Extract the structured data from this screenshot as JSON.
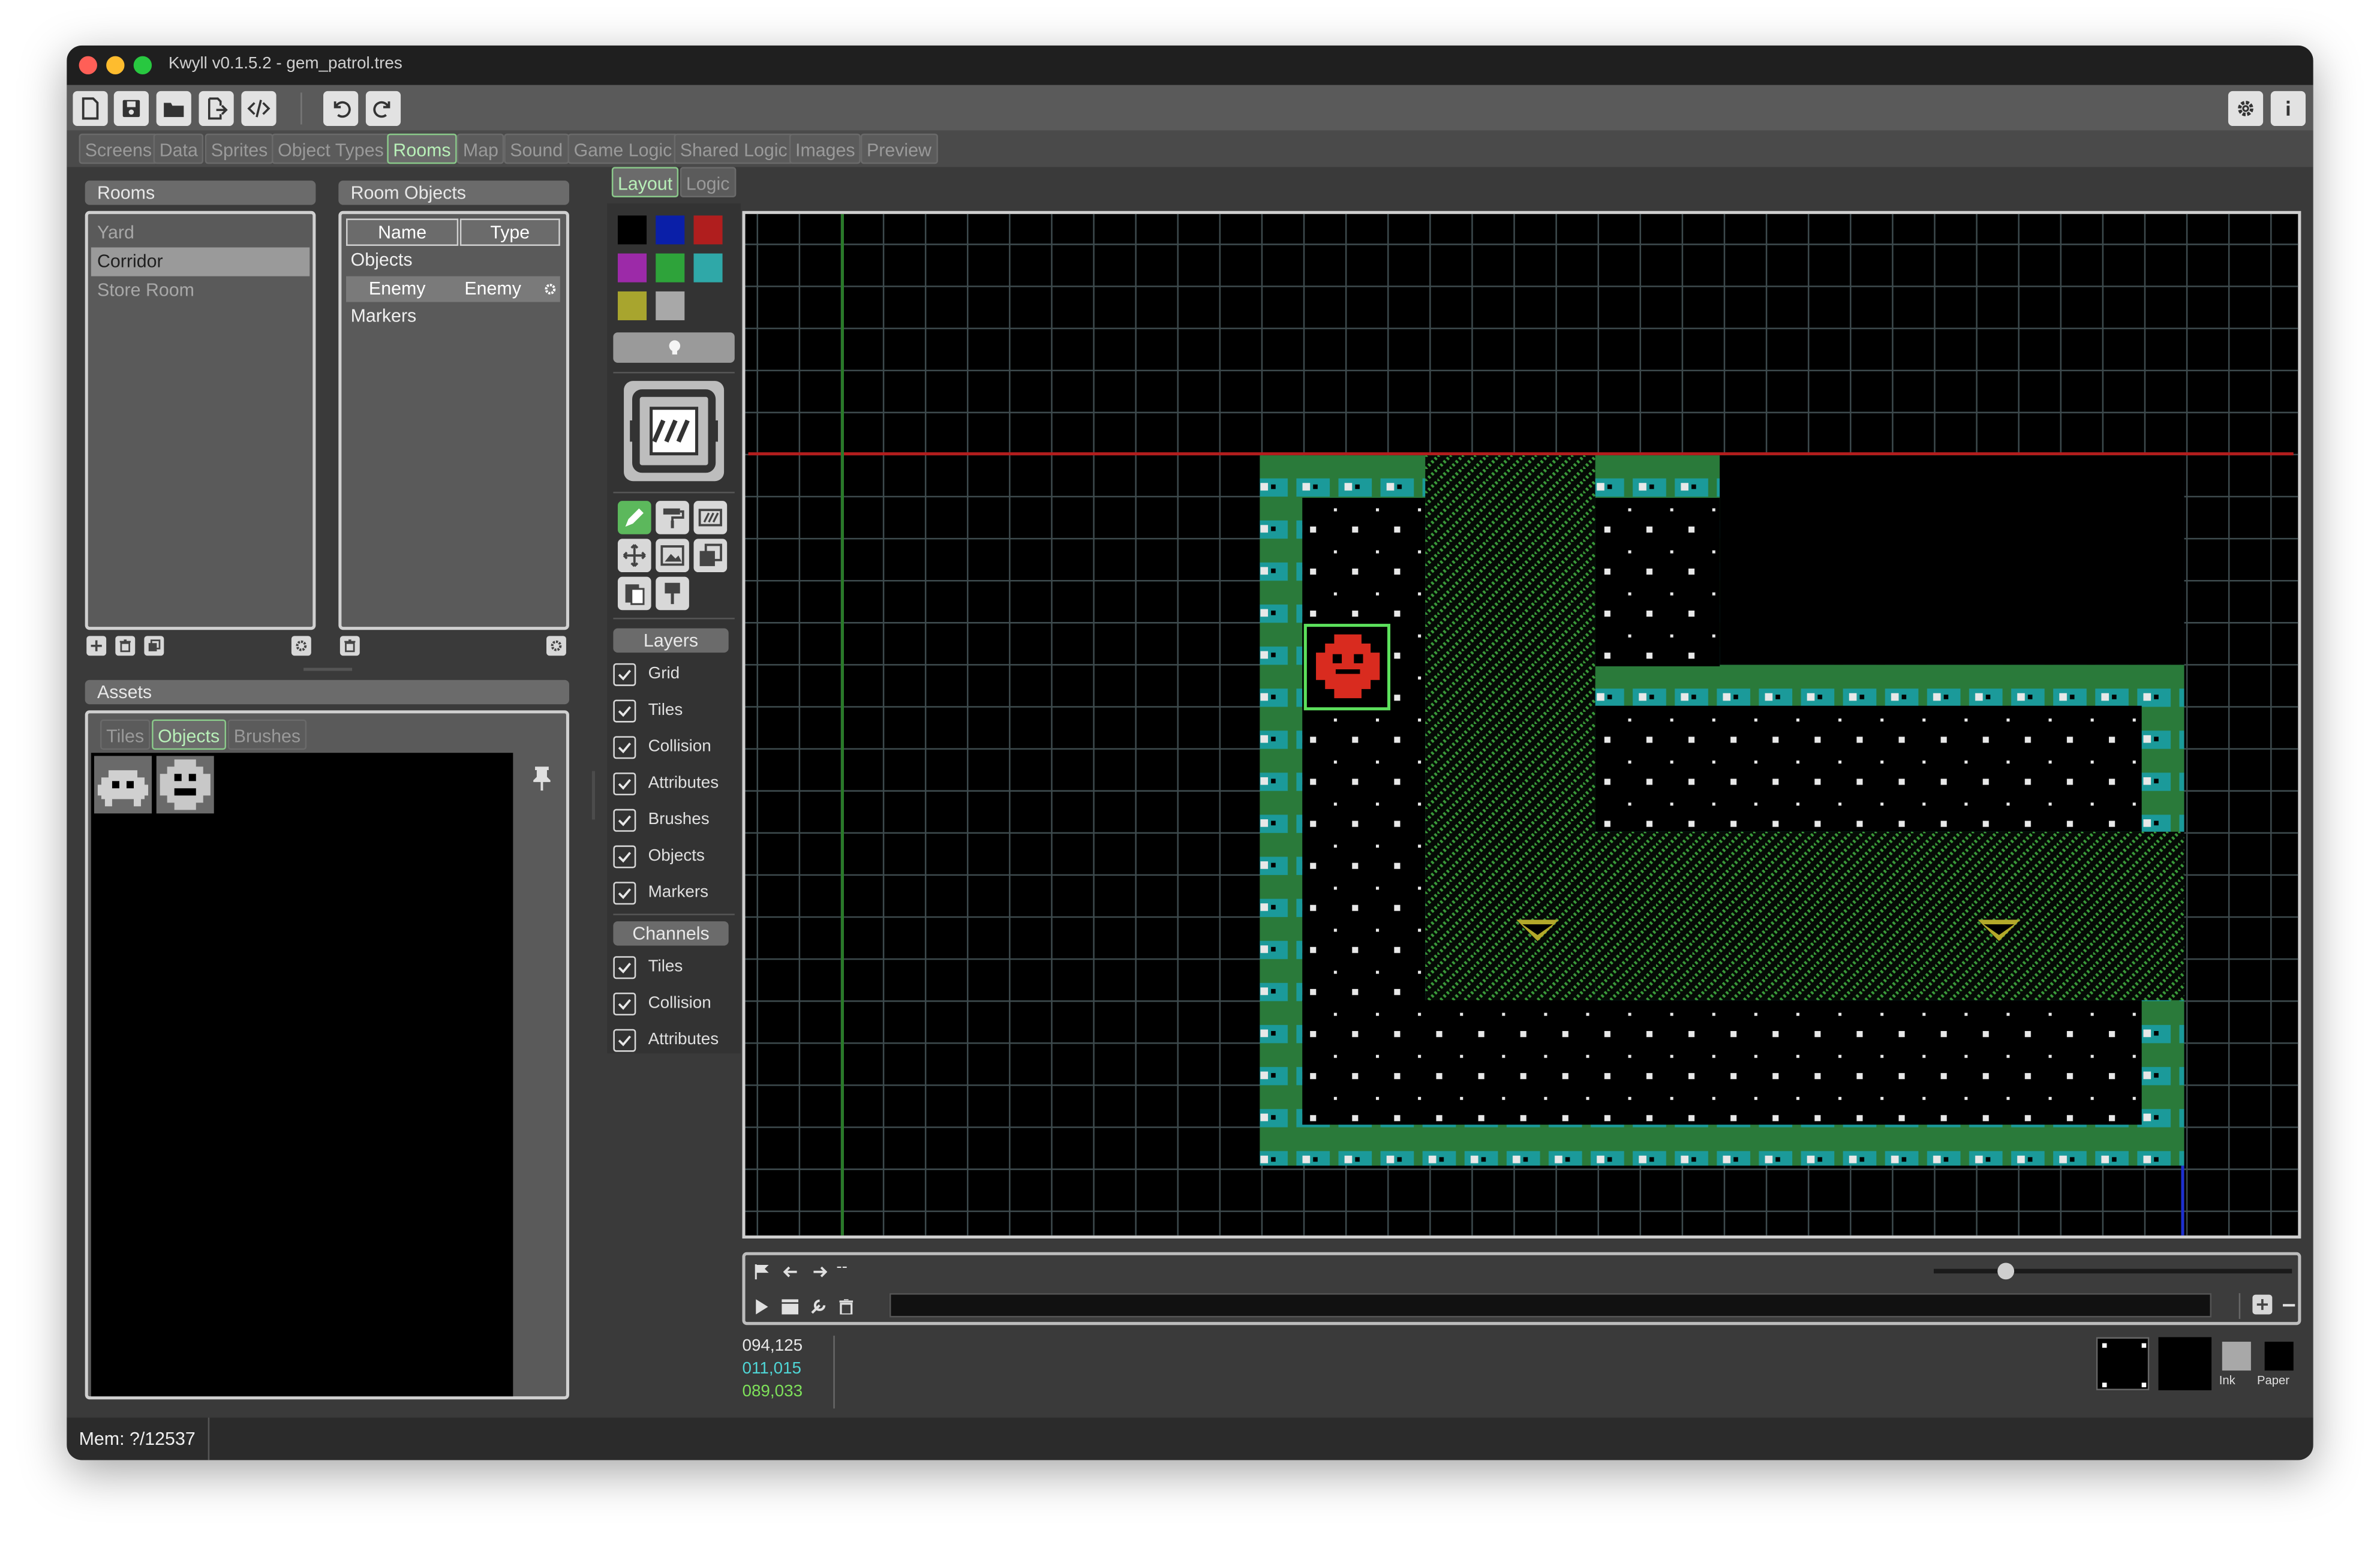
{
  "window": {
    "title": "Kwyll v0.1.5.2 - gem_patrol.tres"
  },
  "toolbar": {
    "left_icons": [
      "new-file-icon",
      "save-icon",
      "open-folder-icon",
      "export-icon",
      "code-icon",
      "undo-icon",
      "redo-icon"
    ],
    "right_icons": [
      "gear-icon",
      "info-icon"
    ]
  },
  "main_tabs": [
    "Screens",
    "Data",
    "Sprites",
    "Object Types",
    "Rooms",
    "Map",
    "Sound",
    "Game Logic",
    "Shared Logic",
    "Images",
    "Preview"
  ],
  "main_tabs_active": "Rooms",
  "rooms": {
    "header": "Rooms",
    "items": [
      "Yard",
      "Corridor",
      "Store Room"
    ],
    "selected": "Corridor"
  },
  "room_objects": {
    "header": "Room Objects",
    "col_name": "Name",
    "col_type": "Type",
    "group_objects": "Objects",
    "row": {
      "name": "Enemy",
      "type": "Enemy"
    },
    "group_markers": "Markers"
  },
  "assets": {
    "header": "Assets",
    "tabs": [
      "Tiles",
      "Objects",
      "Brushes"
    ],
    "active_tab": "Objects"
  },
  "editor_tabs": [
    "Layout",
    "Logic"
  ],
  "editor_tabs_active": "Layout",
  "palette": {
    "colors": [
      "#000000",
      "#0a1fa8",
      "#b01e1e",
      "#9c2aa8",
      "#2ea33a",
      "#2fa8a8",
      "#a8a52e",
      "#a8a8a8"
    ]
  },
  "layers": {
    "header": "Layers",
    "items": [
      "Grid",
      "Tiles",
      "Collision",
      "Attributes",
      "Brushes",
      "Objects",
      "Markers"
    ]
  },
  "channels": {
    "header": "Channels",
    "items": [
      "Tiles",
      "Collision",
      "Attributes"
    ]
  },
  "playback": {
    "position_text": "--",
    "zoom_level": 0.2
  },
  "coords": {
    "line1": "094,125",
    "line2": "011,015",
    "line3": "089,033",
    "colors": {
      "line1": "#e8e8e8",
      "line2": "#4fd6d6",
      "line3": "#7ee05a"
    }
  },
  "ink_paper": {
    "ink_label": "Ink",
    "paper_label": "Paper"
  },
  "status": {
    "mem": "Mem: ?/12537"
  }
}
